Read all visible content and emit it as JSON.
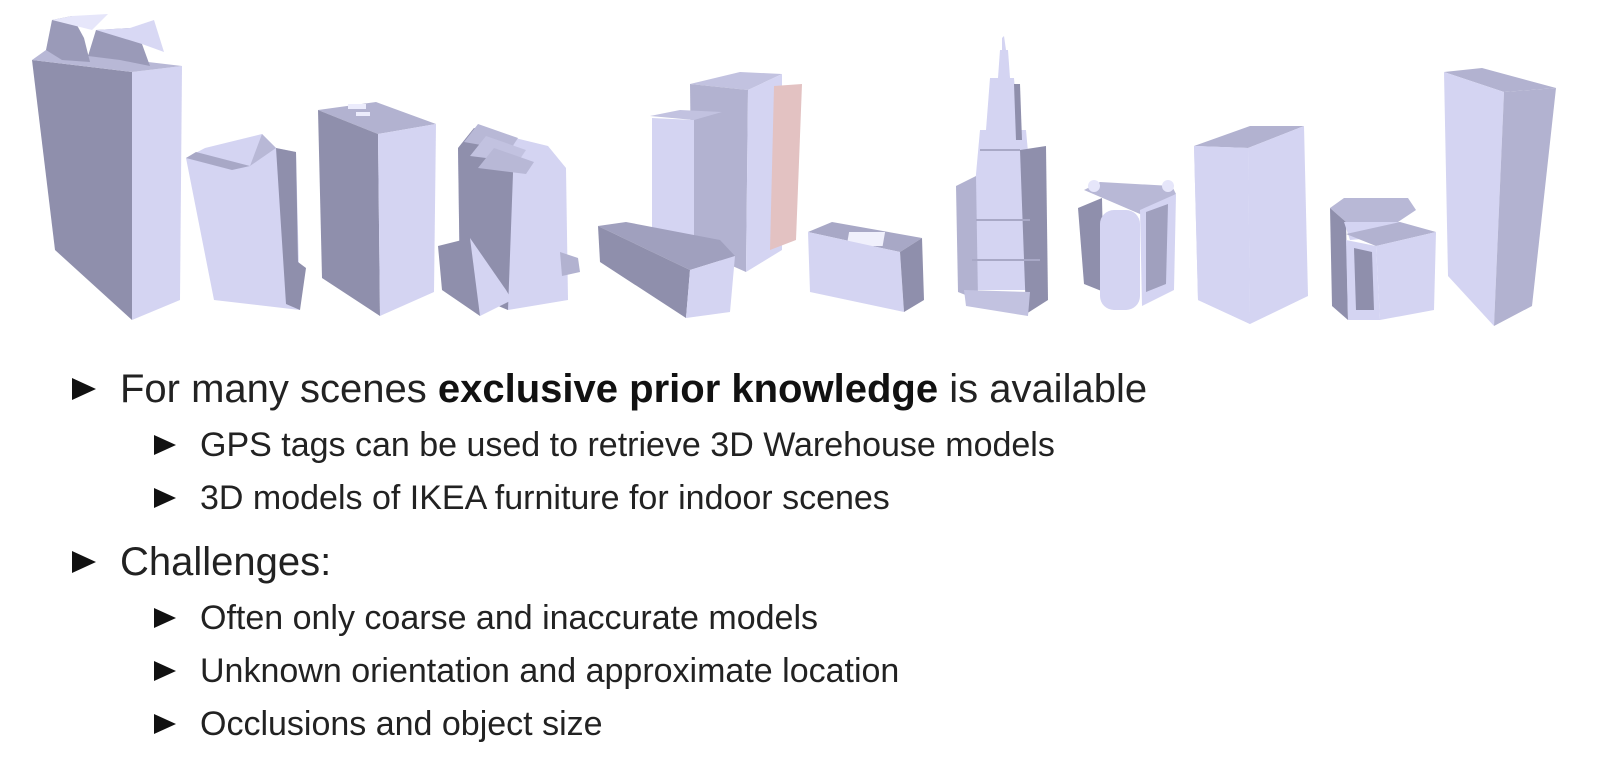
{
  "colors": {
    "building_light": "#d4d4f2",
    "building_mid": "#b2b2d0",
    "building_dark": "#8f8fac",
    "building_accent": "#e3c2c2",
    "text": "#222222",
    "bullet": "#111111"
  },
  "bullets": {
    "b1": {
      "pre": "For many scenes ",
      "bold": "exclusive prior knowledge",
      "post": " is available",
      "sub": [
        "GPS tags can be used to retrieve 3D Warehouse models",
        "3D models of IKEA furniture for indoor scenes"
      ]
    },
    "b2": {
      "text": "Challenges:",
      "sub": [
        "Often only coarse and inaccurate models",
        "Unknown orientation and approximate location",
        "Occlusions and object size"
      ]
    }
  }
}
